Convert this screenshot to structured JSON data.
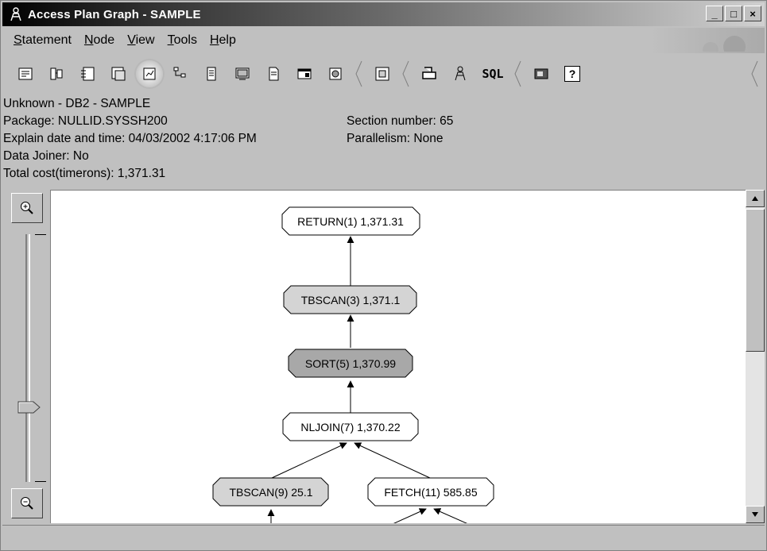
{
  "window": {
    "title": "Access Plan Graph - SAMPLE",
    "minimize": "_",
    "maximize": "□",
    "close": "×"
  },
  "menu": {
    "items": [
      {
        "label": "Statement",
        "mnemonic": "S"
      },
      {
        "label": "Node",
        "mnemonic": "N"
      },
      {
        "label": "View",
        "mnemonic": "V"
      },
      {
        "label": "Tools",
        "mnemonic": "T"
      },
      {
        "label": "Help",
        "mnemonic": "H"
      }
    ]
  },
  "toolbar": {
    "sql_label": "SQL",
    "help_label": "?",
    "icons": [
      "statement-icon",
      "dynamic-explain-icon",
      "explain-sql-icon",
      "show-sql-icon",
      "show-statistics-icon",
      "graph-tree-icon",
      "details-icon",
      "table-icon",
      "index-icon",
      "function-icon",
      "settings-icon",
      "overview-icon",
      "print-icon",
      "wizard-icon",
      "sql-icon",
      "monitor-icon",
      "help-icon"
    ]
  },
  "info": {
    "server": "Unknown - DB2 - SAMPLE",
    "package": "Package: NULLID.SYSSH200",
    "explain": "Explain date and time: 04/03/2002 4:17:06 PM",
    "joiner": "Data Joiner: No",
    "cost": "Total cost(timerons): 1,371.31",
    "section": "Section number: 65",
    "parallelism": "Parallelism: None"
  },
  "graph": {
    "nodes": [
      {
        "label": "RETURN(1) 1,371.31",
        "shade": "white"
      },
      {
        "label": "TBSCAN(3) 1,371.1",
        "shade": "light"
      },
      {
        "label": "SORT(5) 1,370.99",
        "shade": "dark"
      },
      {
        "label": "NLJOIN(7) 1,370.22",
        "shade": "white"
      },
      {
        "label": "TBSCAN(9) 25.1",
        "shade": "light"
      },
      {
        "label": "FETCH(11) 585.85",
        "shade": "white"
      }
    ],
    "colors": {
      "white": "#ffffff",
      "light": "#d4d4d4",
      "dark": "#a8a8a8"
    }
  },
  "zoom": {
    "level_fraction": 0.3
  }
}
